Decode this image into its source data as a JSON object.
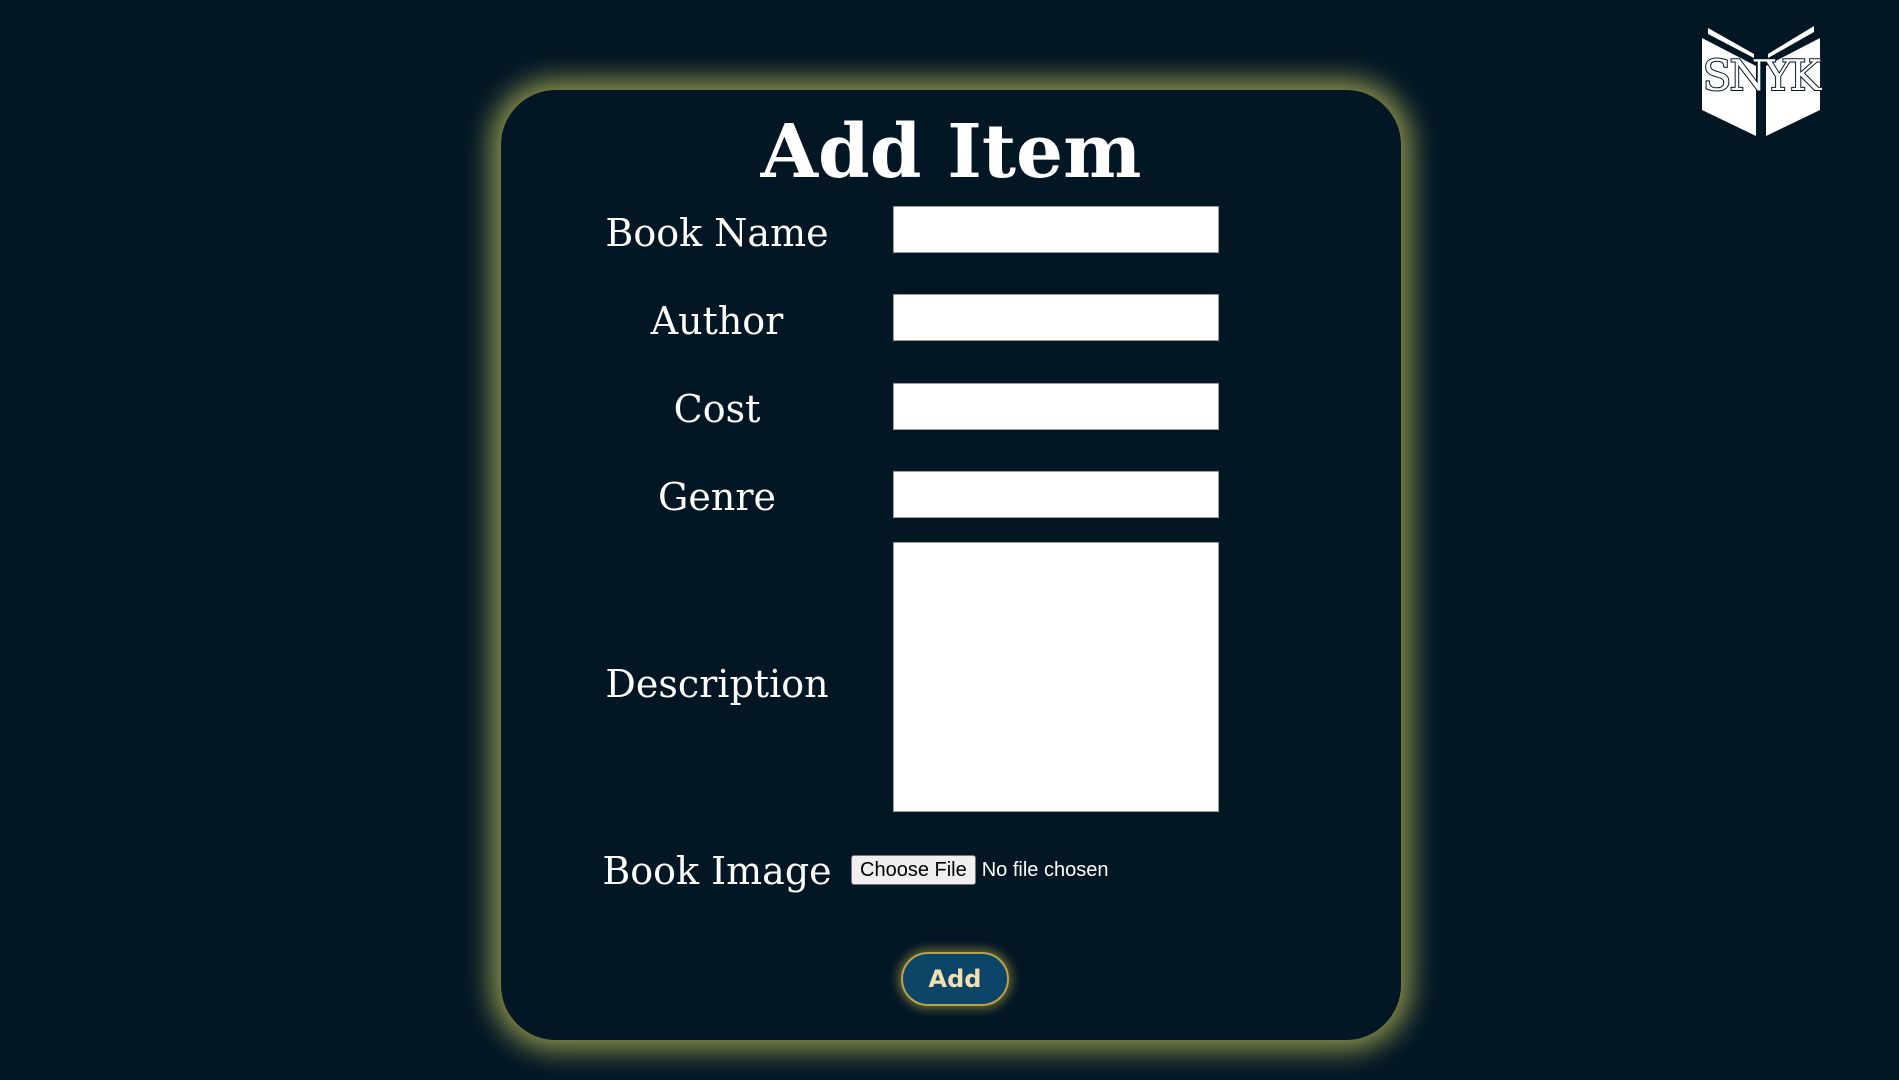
{
  "logo": {
    "text": "SNYK",
    "icon": "open-book-icon"
  },
  "form": {
    "title": "Add Item",
    "fields": [
      {
        "label": "Book Name",
        "value": "",
        "placeholder": ""
      },
      {
        "label": "Author",
        "value": "",
        "placeholder": ""
      },
      {
        "label": "Cost",
        "value": "",
        "placeholder": ""
      },
      {
        "label": "Genre",
        "value": "",
        "placeholder": ""
      },
      {
        "label": "Description",
        "value": "",
        "placeholder": ""
      }
    ],
    "image_field": {
      "label": "Book Image",
      "button_label": "Choose File",
      "status": "No file chosen"
    },
    "submit_label": "Add"
  },
  "colors": {
    "background": "#021624",
    "card_glow": "#bebe5a",
    "button_fill": "#0d4569",
    "button_text": "#f3dfb0",
    "text": "#ffffff"
  }
}
